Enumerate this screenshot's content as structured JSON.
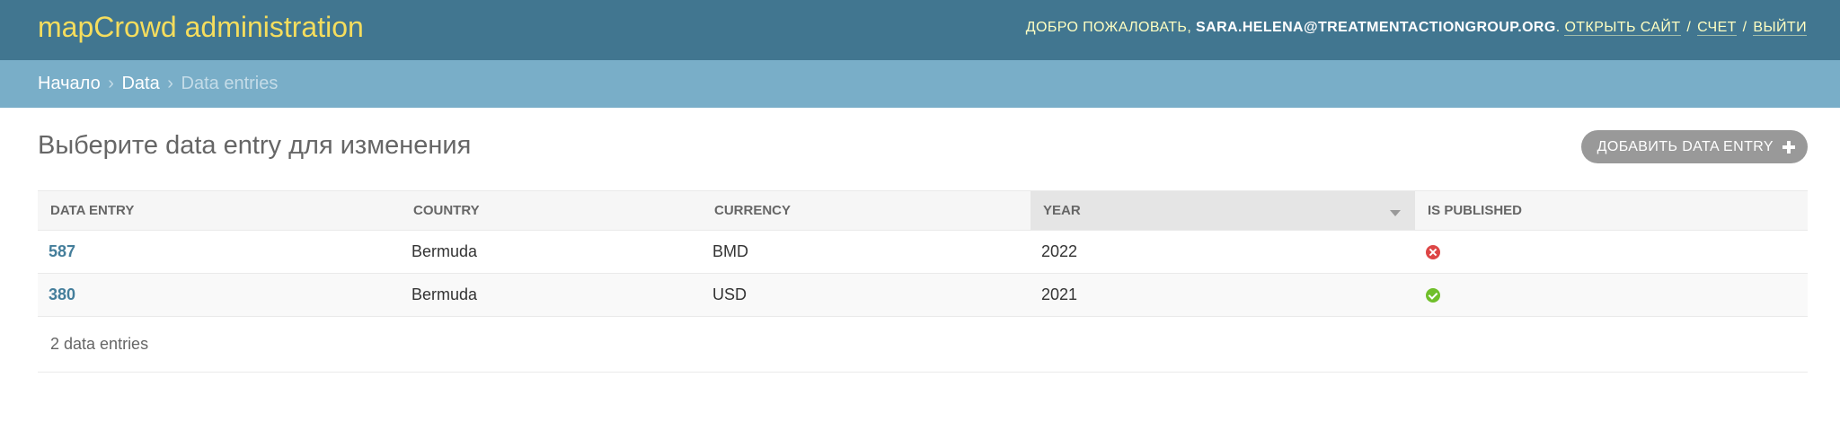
{
  "header": {
    "brand": "mapCrowd administration",
    "welcome": "Добро пожаловать,",
    "user_email": "sara.helena@treatmentactiongroup.org",
    "punct": ".",
    "links": {
      "view_site": "Открыть сайт",
      "account": "Счет",
      "logout": "Выйти"
    },
    "separator": "/"
  },
  "breadcrumbs": {
    "home": "Начало",
    "section": "Data",
    "current": "Data entries",
    "separator": "›"
  },
  "page": {
    "title": "Выберите data entry для изменения",
    "add_button": "Добавить data entry"
  },
  "table": {
    "columns": {
      "data_entry": "Data entry",
      "country": "Country",
      "currency": "Currency",
      "year": "Year",
      "is_published": "Is published"
    },
    "sorted_column": "year",
    "rows": [
      {
        "id": "587",
        "country": "Bermuda",
        "currency": "BMD",
        "year": "2022",
        "is_published": false
      },
      {
        "id": "380",
        "country": "Bermuda",
        "currency": "USD",
        "year": "2021",
        "is_published": true
      }
    ]
  },
  "paginator": {
    "count_text": "2 data entries"
  },
  "colors": {
    "header_bg": "#417690",
    "brand": "#f5dd5d",
    "breadcrumbs_bg": "#79aec8",
    "link": "#447e9b",
    "published_yes": "#70bf2b",
    "published_no": "#dd4646"
  },
  "icons": {
    "add": "plus-icon",
    "sort": "sort-descending-icon",
    "published_yes": "check-circle-icon",
    "published_no": "x-circle-icon"
  }
}
